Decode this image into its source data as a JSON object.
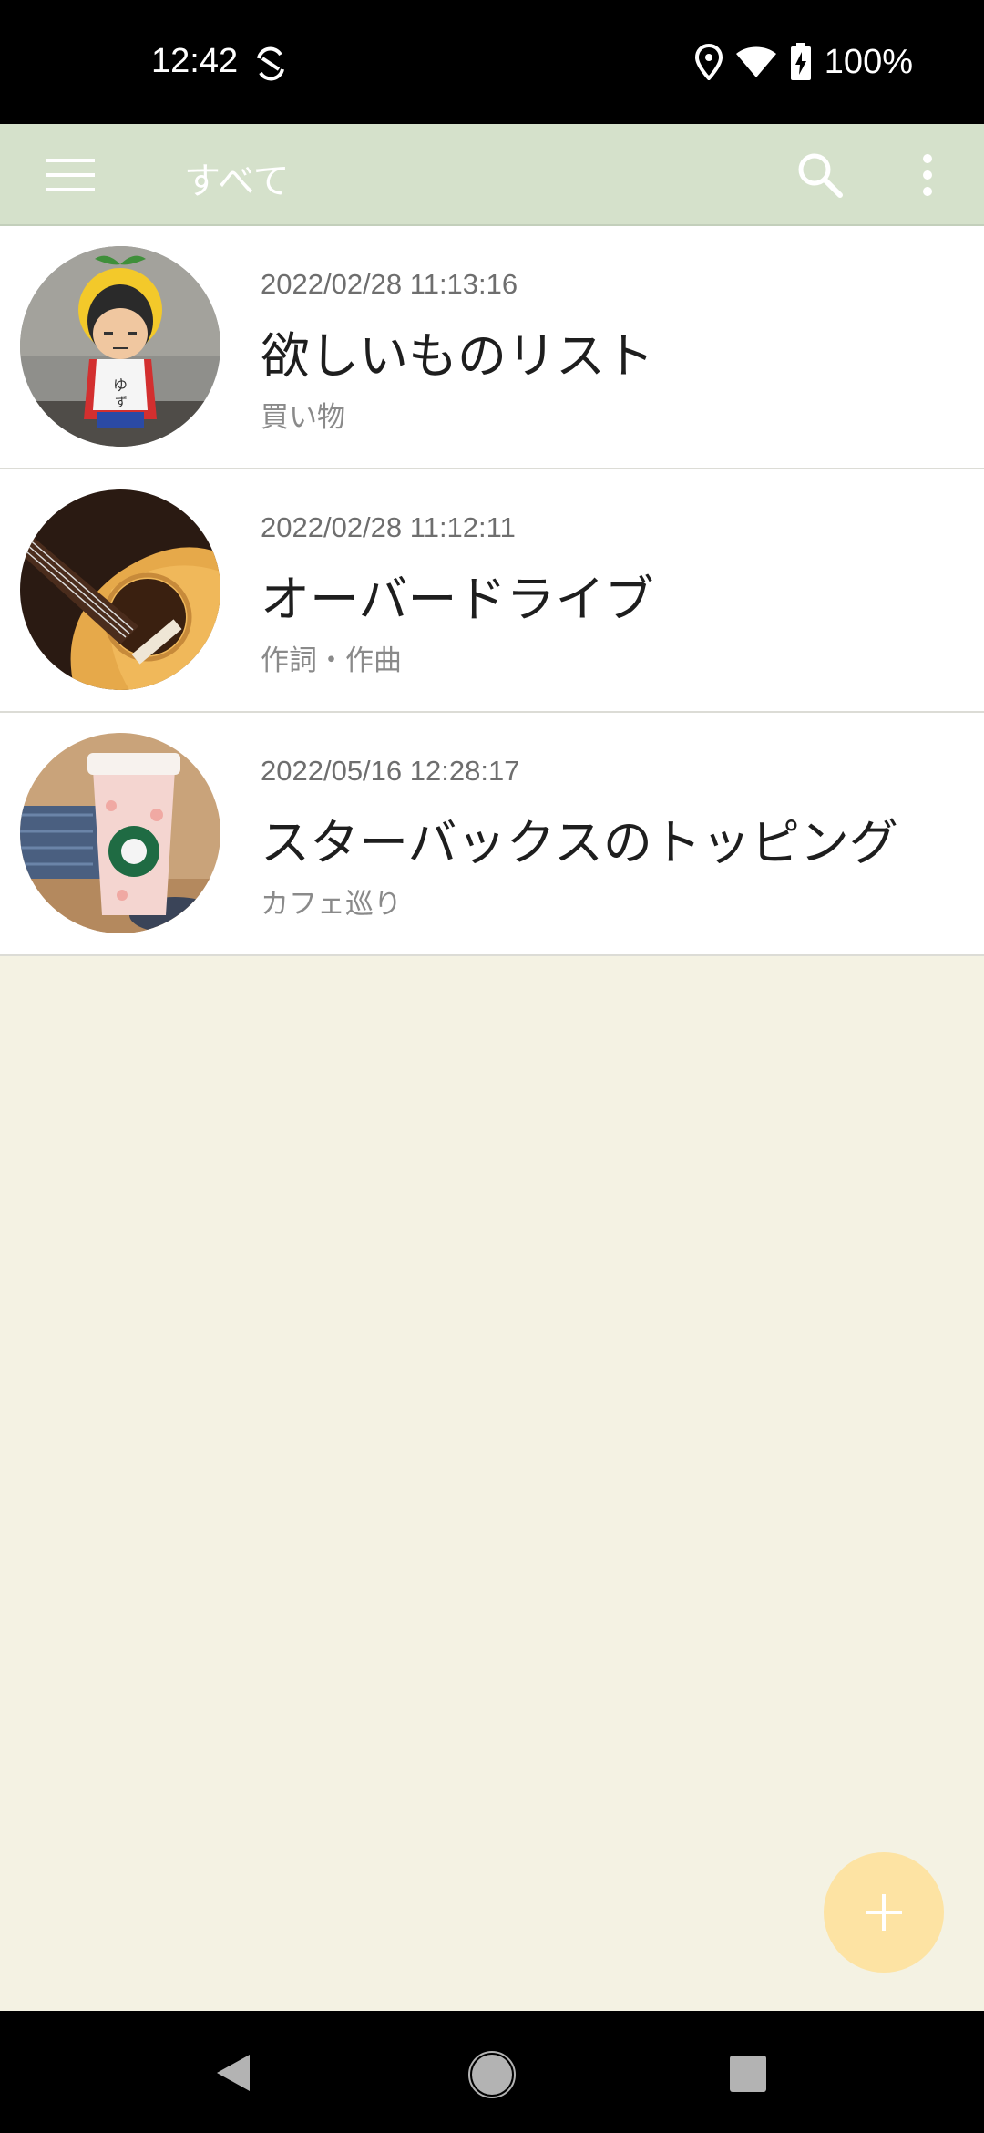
{
  "status_bar": {
    "time": "12:42",
    "battery": "100%",
    "icons": [
      "sync-icon",
      "location-icon",
      "wifi-icon",
      "battery-charging-icon"
    ]
  },
  "toolbar": {
    "title": "すべて",
    "icons": [
      "menu-icon",
      "search-icon",
      "more-vert-icon"
    ],
    "background_color": "#d5e1cb"
  },
  "items": [
    {
      "date": "2022/02/28 11:13:16",
      "title": "欲しいものリスト",
      "category": "買い物",
      "thumbnail": "figurine-photo"
    },
    {
      "date": "2022/02/28 11:12:11",
      "title": "オーバードライブ",
      "category": "作詞・作曲",
      "thumbnail": "guitar-photo"
    },
    {
      "date": "2022/05/16 12:28:17",
      "title": "スターバックスのトッピング",
      "category": "カフェ巡り",
      "thumbnail": "coffee-cup-photo"
    }
  ],
  "fab": {
    "icon": "plus-icon",
    "color": "#fde3a3"
  },
  "nav_bar": {
    "icons": [
      "back-icon",
      "home-icon",
      "recents-icon"
    ]
  },
  "colors": {
    "background": "#f4f2e3",
    "card": "#ffffff"
  }
}
